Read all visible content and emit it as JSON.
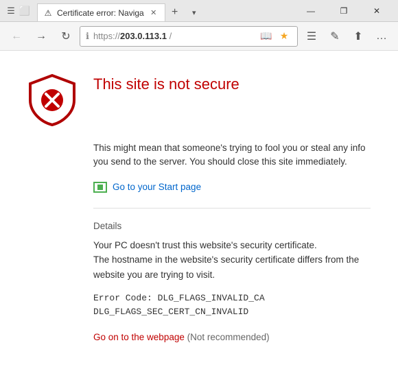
{
  "titlebar": {
    "tab": {
      "title": "Certificate error: Naviga",
      "favicon": "⚠"
    },
    "new_tab_label": "+",
    "window_controls": {
      "minimize": "—",
      "restore": "❐",
      "close": "✕"
    }
  },
  "toolbar": {
    "back_tooltip": "Back",
    "forward_tooltip": "Forward",
    "refresh_tooltip": "Refresh",
    "address": {
      "protocol": "https://",
      "domain": "203.0.113.1",
      "path": " /"
    },
    "reading_view": "📖",
    "favorites": "☆",
    "hub_tooltip": "Hub",
    "notes_tooltip": "Make a Web Note",
    "share_tooltip": "Share",
    "more_tooltip": "..."
  },
  "main": {
    "error_title": "This site is not secure",
    "error_desc": "This might mean that someone's trying to fool you or steal any info you send to the server. You should close this site immediately.",
    "start_page_link": "Go to your Start page",
    "details_label": "Details",
    "details_text_1": "Your PC doesn't trust this website's security certificate.",
    "details_text_2": "The hostname in the website's security certificate differs from the website you are trying to visit.",
    "error_code_line1": "Error Code:  DLG_FLAGS_INVALID_CA",
    "error_code_line2": "DLG_FLAGS_SEC_CERT_CN_INVALID",
    "go_on_link": "Go on to the webpage",
    "not_recommended": "(Not recommended)"
  }
}
